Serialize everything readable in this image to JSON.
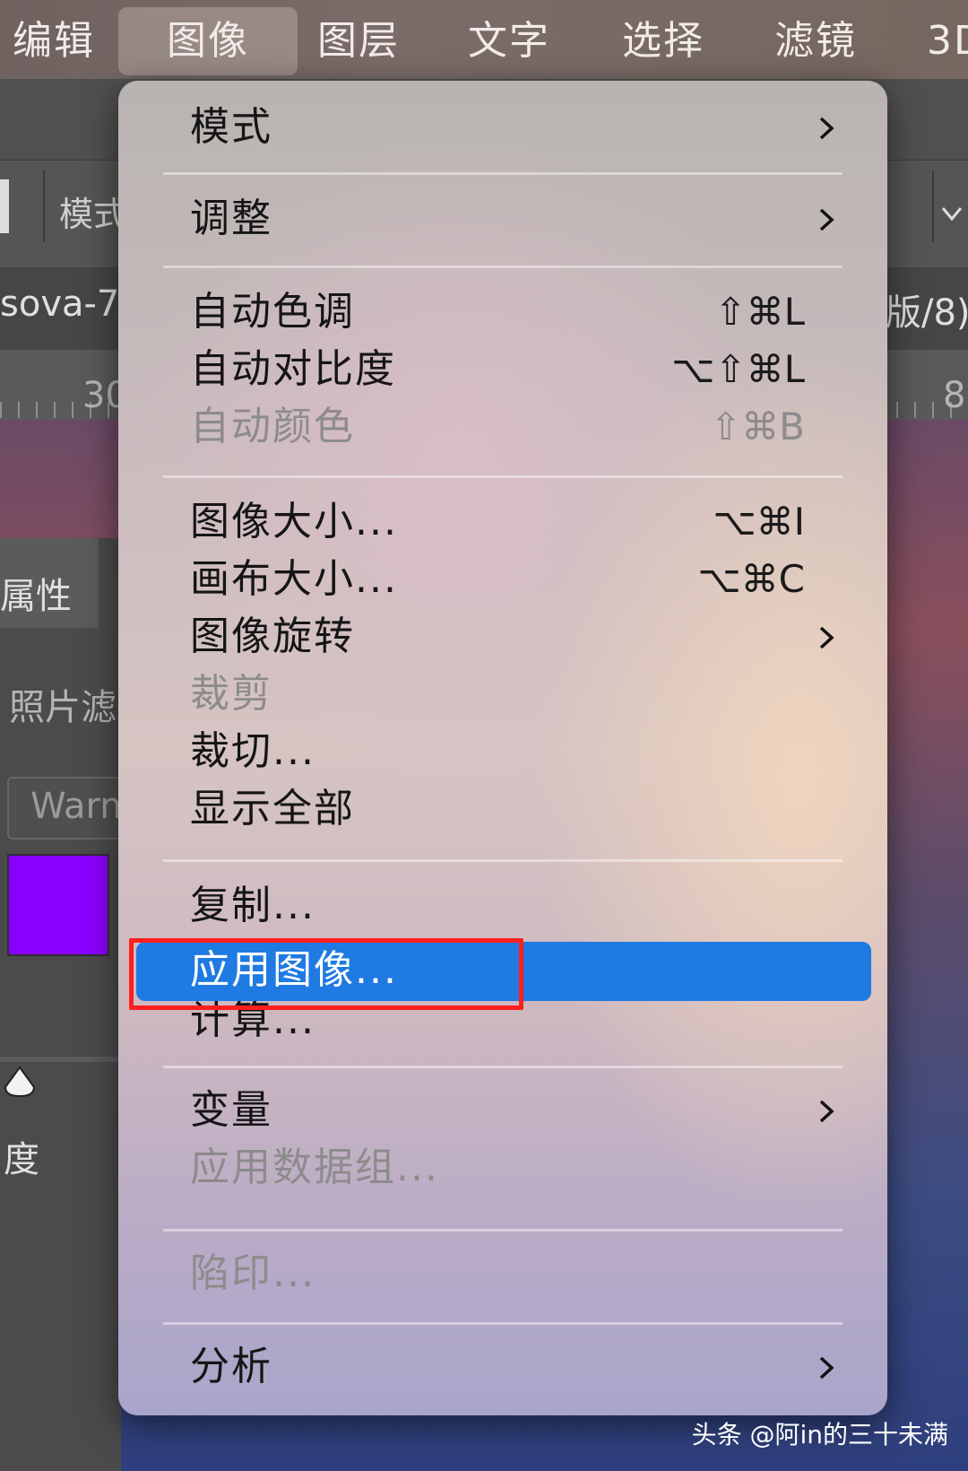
{
  "menubar": {
    "items": [
      "编辑",
      "图像",
      "图层",
      "文字",
      "选择",
      "滤镜",
      "3D"
    ],
    "active": "图像"
  },
  "background": {
    "options_label": "模式",
    "doc_title_left": "sova-7",
    "doc_title_right": "版/8)",
    "ruler_left": "30",
    "ruler_right": "8",
    "panel_tab": "属性",
    "panel_label": "照片滤",
    "field_value": "Warm",
    "slider_label": "度",
    "swatch_color": "#8a00ff"
  },
  "menu": {
    "items": [
      {
        "label": "模式",
        "submenu": true
      },
      {
        "label": "调整",
        "submenu": true
      },
      {
        "label": "自动色调",
        "shortcut": "⇧⌘L"
      },
      {
        "label": "自动对比度",
        "shortcut": "⌥⇧⌘L"
      },
      {
        "label": "自动颜色",
        "shortcut": "⇧⌘B",
        "disabled": true
      },
      {
        "label": "图像大小...",
        "shortcut": "⌥⌘I"
      },
      {
        "label": "画布大小...",
        "shortcut": "⌥⌘C"
      },
      {
        "label": "图像旋转",
        "submenu": true
      },
      {
        "label": "裁剪",
        "disabled": true
      },
      {
        "label": "裁切..."
      },
      {
        "label": "显示全部"
      },
      {
        "label": "复制..."
      },
      {
        "label": "应用图像...",
        "highlighted": true
      },
      {
        "label": "计算..."
      },
      {
        "label": "变量",
        "submenu": true
      },
      {
        "label": "应用数据组...",
        "disabled": true
      },
      {
        "label": "陷印...",
        "disabled": true
      },
      {
        "label": "分析",
        "submenu": true
      }
    ]
  },
  "colors": {
    "highlight": "#1f7ae2",
    "annotation_box": "#ff1e1e"
  },
  "watermark": "头条 @阿in的三十未满"
}
